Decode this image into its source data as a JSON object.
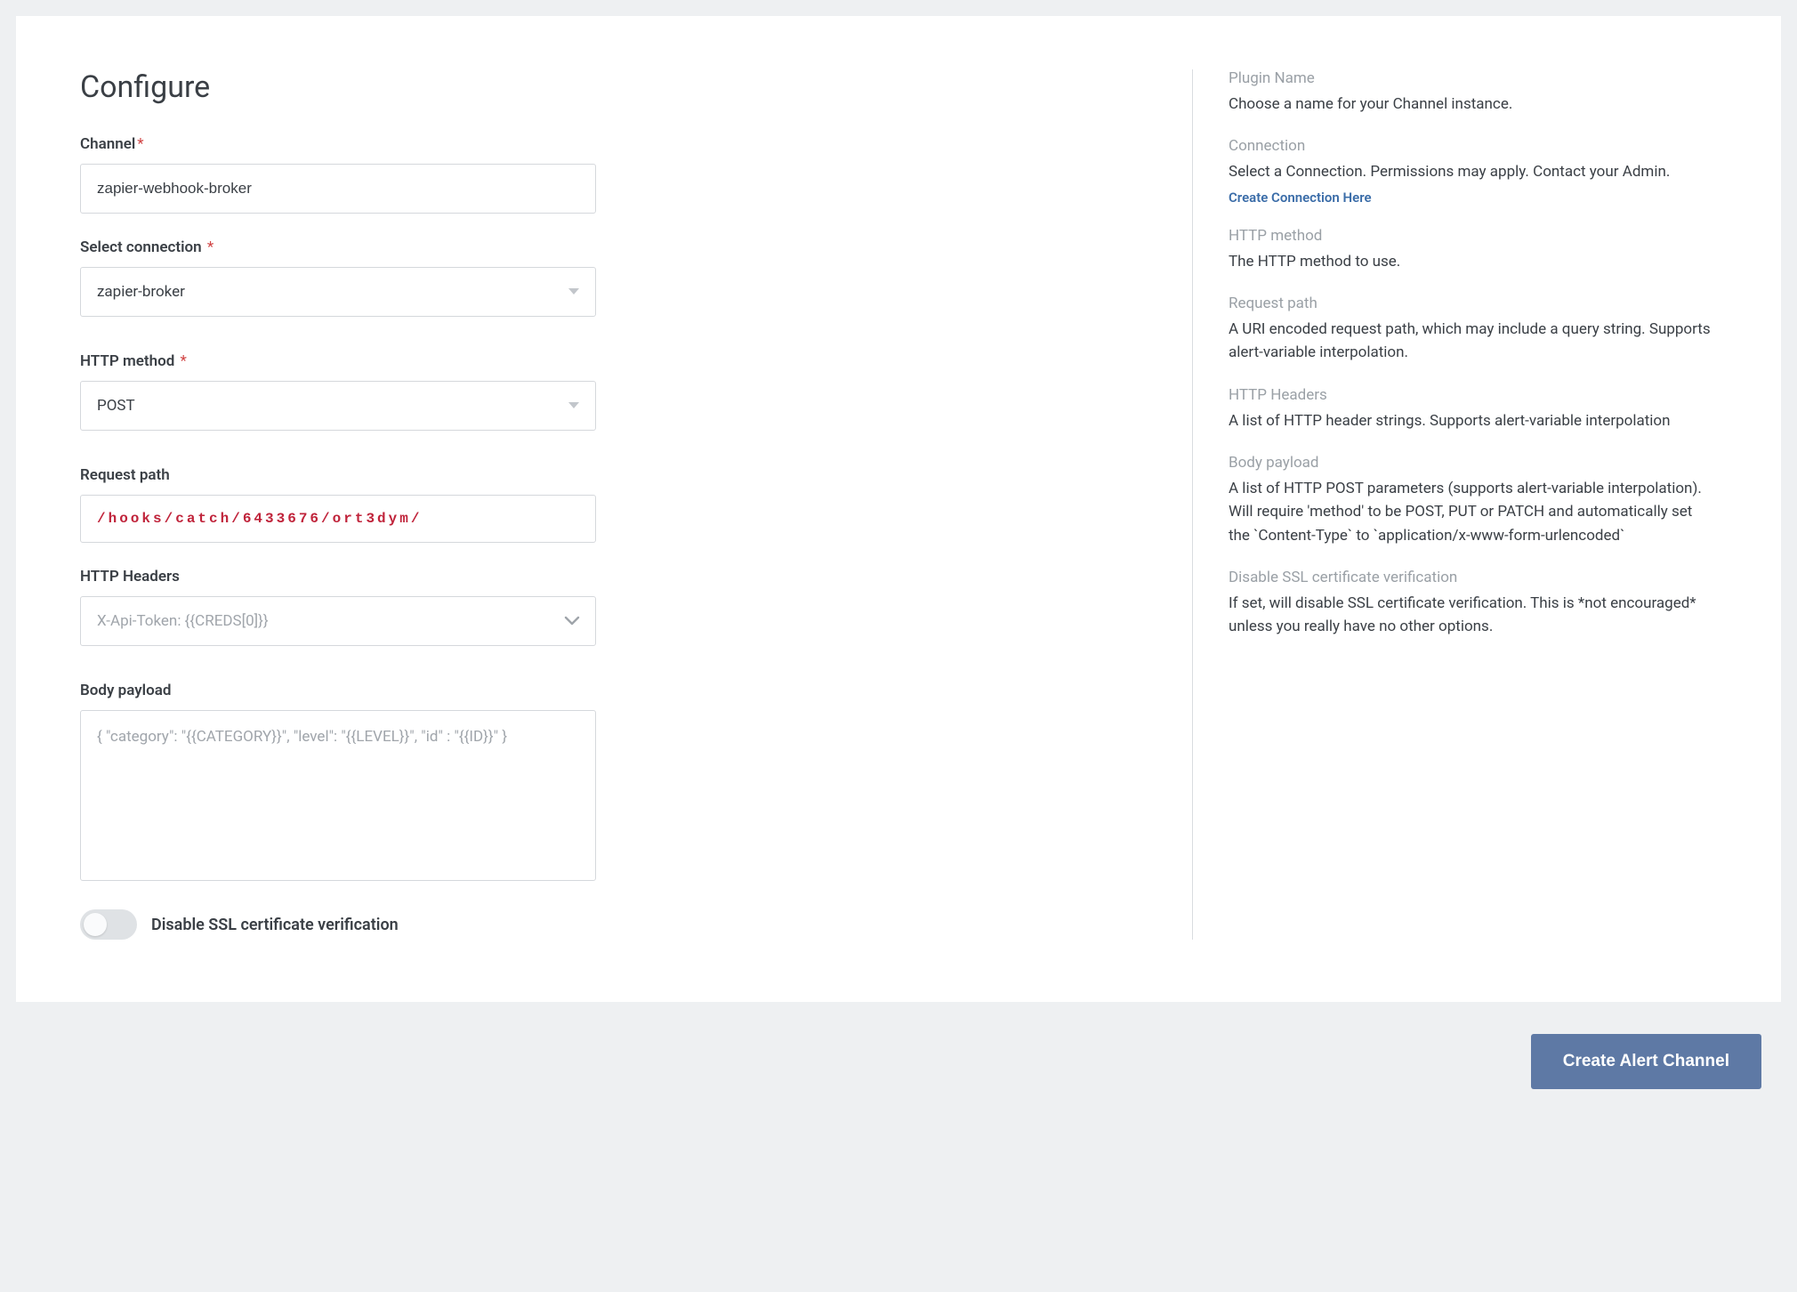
{
  "heading": "Configure",
  "form": {
    "channel": {
      "label": "Channel",
      "required_marker": "*",
      "value": "zapier-webhook-broker"
    },
    "connection": {
      "label": "Select connection",
      "required_marker": "*",
      "value": "zapier-broker"
    },
    "http_method": {
      "label": "HTTP method",
      "required_marker": "*",
      "value": "POST"
    },
    "request_path": {
      "label": "Request path",
      "value": "/hooks/catch/6433676/ort3dym/"
    },
    "http_headers": {
      "label": "HTTP Headers",
      "placeholder": "X-Api-Token: {{CREDS[0]}}"
    },
    "body_payload": {
      "label": "Body payload",
      "placeholder": "{ \"category\": \"{{CATEGORY}}\", \"level\": \"{{LEVEL}}\", \"id\" : \"{{ID}}\" }"
    },
    "disable_ssl": {
      "label": "Disable SSL certificate verification",
      "value": false
    }
  },
  "help": {
    "plugin_name": {
      "title": "Plugin Name",
      "body": "Choose a name for your Channel instance."
    },
    "connection": {
      "title": "Connection",
      "body": "Select a Connection. Permissions may apply. Contact your Admin.",
      "link": "Create Connection Here"
    },
    "http_method": {
      "title": "HTTP method",
      "body": "The HTTP method to use."
    },
    "request_path": {
      "title": "Request path",
      "body": "A URI encoded request path, which may include a query string. Supports alert-variable interpolation."
    },
    "http_headers": {
      "title": "HTTP Headers",
      "body": "A list of HTTP header strings. Supports alert-variable interpolation"
    },
    "body_payload": {
      "title": "Body payload",
      "body": "A list of HTTP POST parameters (supports alert-variable interpolation). Will require 'method' to be POST, PUT or PATCH and automatically set the `Content-Type` to `application/x-www-form-urlencoded`"
    },
    "disable_ssl": {
      "title": "Disable SSL certificate verification",
      "body": "If set, will disable SSL certificate verification. This is *not encouraged* unless you really have no other options."
    }
  },
  "footer": {
    "create_button": "Create Alert Channel"
  }
}
